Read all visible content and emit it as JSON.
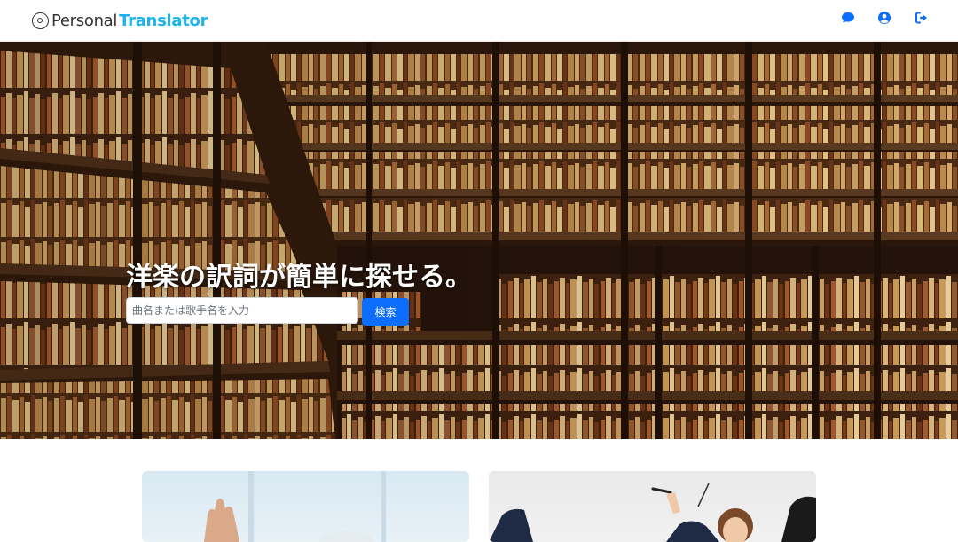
{
  "brand": {
    "name_part1": "Personal",
    "name_part2": "Translator",
    "accent_color": "#1eb4e8"
  },
  "header": {
    "icons": [
      "chat-icon",
      "user-circle-icon",
      "sign-out-icon"
    ],
    "icon_color": "#0d6efd"
  },
  "hero": {
    "title": "洋楽の訳詞が簡単に探せる。",
    "search": {
      "placeholder": "曲名または歌手名を入力",
      "value": "",
      "button_label": "検索",
      "button_color": "#0d6efd"
    }
  },
  "cards": [
    {
      "image": "raised-hands-photo"
    },
    {
      "image": "conductor-photo"
    }
  ]
}
